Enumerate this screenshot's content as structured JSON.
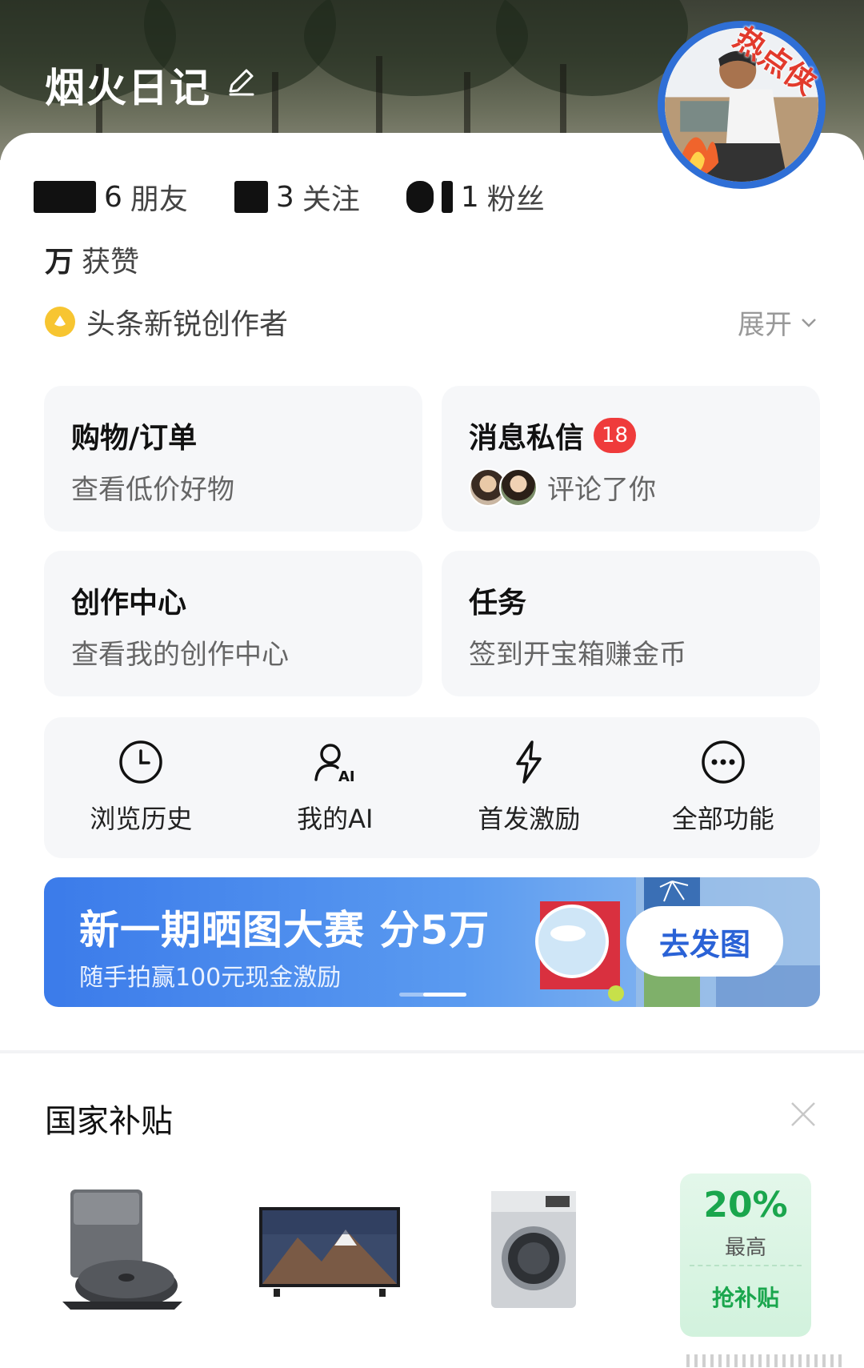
{
  "header": {
    "title": "烟火日记",
    "hot_badge": "热点侠"
  },
  "stats": [
    {
      "value": "6",
      "label": "朋友"
    },
    {
      "value": "3",
      "label": "关注"
    },
    {
      "value": "1",
      "label": "粉丝"
    }
  ],
  "likes": {
    "value": "万",
    "label": "获赞"
  },
  "creator": {
    "label": "头条新锐创作者",
    "expand_label": "展开"
  },
  "tiles": {
    "shopping": {
      "title": "购物/订单",
      "subtitle": "查看低价好物"
    },
    "messages": {
      "title": "消息私信",
      "badge": "18",
      "subtitle": "评论了你"
    },
    "creation": {
      "title": "创作中心",
      "subtitle": "查看我的创作中心"
    },
    "tasks": {
      "title": "任务",
      "subtitle": "签到开宝箱赚金币"
    }
  },
  "quick_actions": [
    {
      "label": "浏览历史",
      "icon": "clock-icon"
    },
    {
      "label": "我的AI",
      "icon": "ai-person-icon"
    },
    {
      "label": "首发激励",
      "icon": "lightning-icon"
    },
    {
      "label": "全部功能",
      "icon": "more-dots-icon"
    }
  ],
  "banner": {
    "title": "新一期晒图大赛 分5万",
    "subtitle": "随手拍赢100元现金激励",
    "button": "去发图"
  },
  "subsidy": {
    "title": "国家补贴",
    "promo": {
      "percent": "20%",
      "max_label": "最高",
      "button": "抢补贴"
    }
  },
  "colors": {
    "accent_blue": "#2f6fd6",
    "badge_red": "#ef3b3b",
    "promo_green": "#1aa64d"
  }
}
